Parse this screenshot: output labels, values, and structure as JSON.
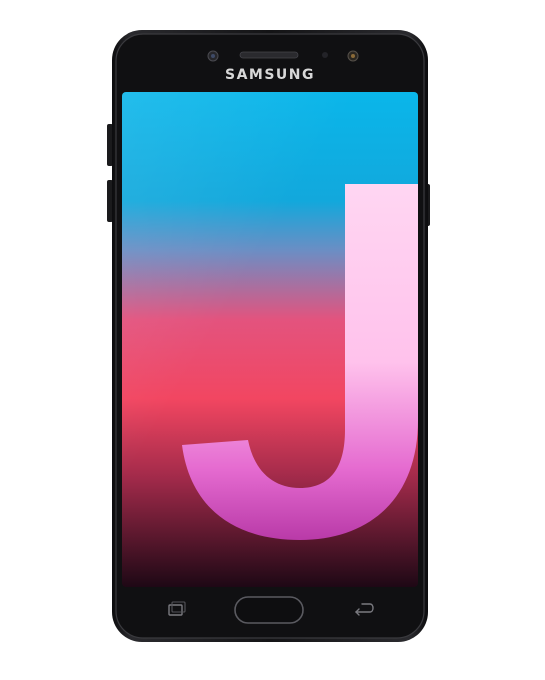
{
  "device": {
    "brand_label": "SAMSUNG",
    "body_color": "#141416",
    "screen_top_color": "#08b8e8",
    "screen_mid_color": "#f04a78",
    "screen_bottom_color": "#2a0a20",
    "logo_letter_color": "#ffc8ee"
  },
  "icons": {
    "front_camera": "front-camera-icon",
    "earpiece": "earpiece-icon",
    "sensor": "proximity-sensor-icon",
    "flash": "front-flash-icon",
    "recent_apps": "recent-apps-icon",
    "home_button": "home-button-icon",
    "back": "back-arrow-icon"
  }
}
